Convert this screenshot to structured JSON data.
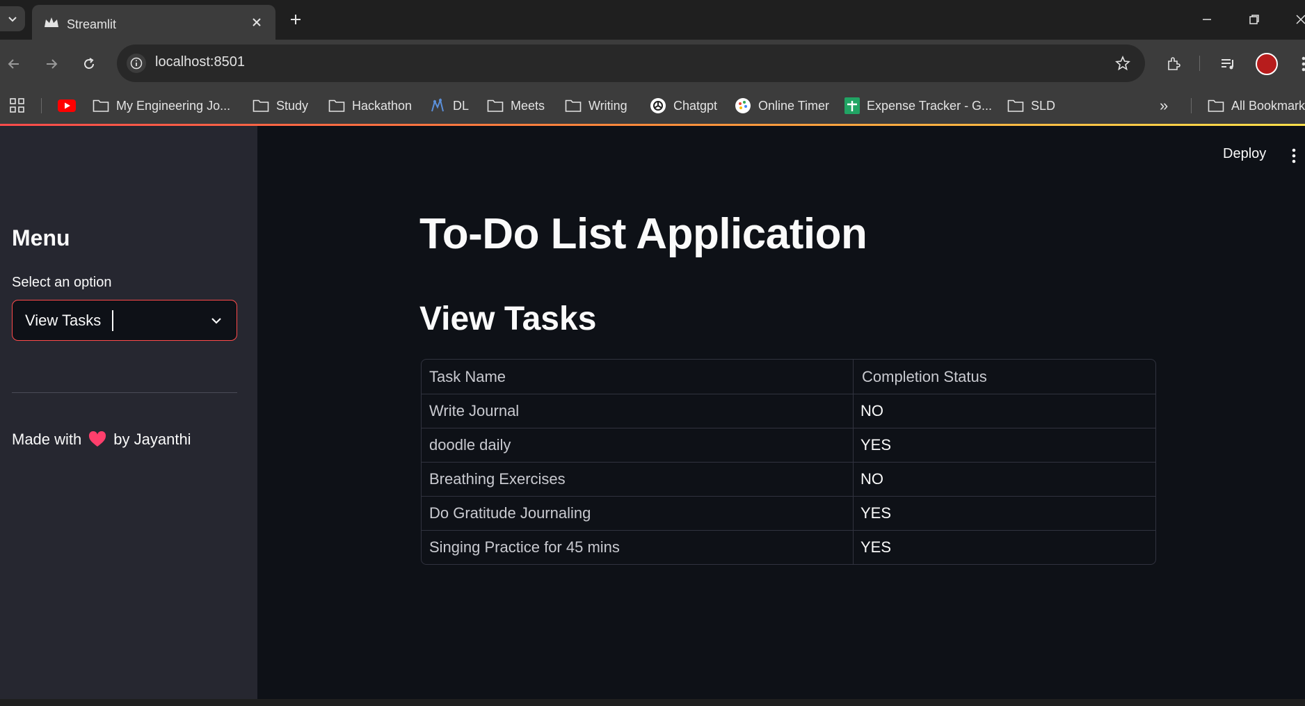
{
  "browser": {
    "tab_title": "Streamlit",
    "url": "localhost:8501",
    "bookmarks": [
      {
        "label": "",
        "icon": "youtube-icon"
      },
      {
        "label": "My Engineering Jo...",
        "icon": "folder-icon"
      },
      {
        "label": "Study",
        "icon": "folder-icon"
      },
      {
        "label": "Hackathon",
        "icon": "folder-icon"
      },
      {
        "label": "DL",
        "icon": "dl-icon"
      },
      {
        "label": "Meets",
        "icon": "folder-icon"
      },
      {
        "label": "Writing",
        "icon": "folder-icon"
      },
      {
        "label": "Chatgpt",
        "icon": "chatgpt-icon"
      },
      {
        "label": "Online Timer",
        "icon": "timer-icon"
      },
      {
        "label": "Expense Tracker - G...",
        "icon": "sheets-icon"
      },
      {
        "label": "SLD",
        "icon": "folder-icon"
      }
    ],
    "more_bookmarks": "»",
    "all_bookmarks": "All Bookmarks"
  },
  "sidebar": {
    "menu_title": "Menu",
    "select_label": "Select an option",
    "select_value": "View Tasks",
    "credit_before": "Made with",
    "credit_after": "by Jayanthi"
  },
  "main": {
    "deploy_label": "Deploy",
    "title": "To-Do List Application",
    "subtitle": "View Tasks",
    "table": {
      "headers": [
        "Task Name",
        "Completion Status"
      ],
      "rows": [
        [
          "Write Journal",
          "NO"
        ],
        [
          "doodle daily",
          "YES"
        ],
        [
          "Breathing Exercises",
          "NO"
        ],
        [
          "Do Gratitude Journaling",
          "YES"
        ],
        [
          "Singing Practice for 45 mins",
          "YES"
        ]
      ]
    }
  },
  "colors": {
    "accent": "#ff4b4b",
    "app_background": "#0e1117",
    "sidebar_background": "#262730"
  }
}
